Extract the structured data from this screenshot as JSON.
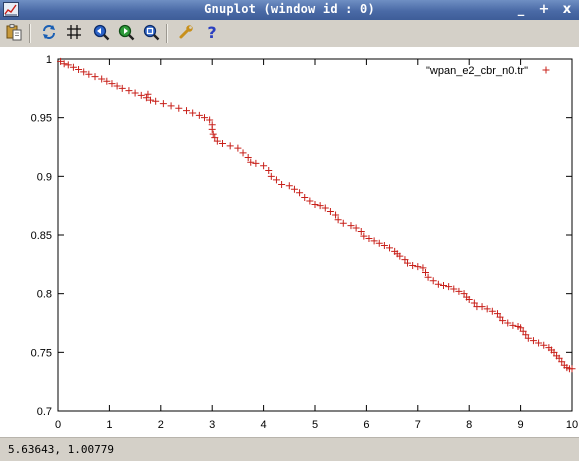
{
  "window": {
    "title": "Gnuplot (window id : 0)",
    "controls": {
      "minimize": "_",
      "maximize": "+",
      "close": "x"
    }
  },
  "toolbar": {
    "buttons": [
      {
        "name": "copy-to-clipboard",
        "icon": "clipboard-icon"
      },
      {
        "name": "replot",
        "icon": "replot-icon"
      },
      {
        "name": "toggle-grid",
        "icon": "grid-icon"
      },
      {
        "name": "previous-zoom",
        "icon": "zoom-previous-icon"
      },
      {
        "name": "next-zoom",
        "icon": "zoom-next-icon"
      },
      {
        "name": "autoscale",
        "icon": "zoom-autoscale-icon"
      },
      {
        "name": "options",
        "icon": "wrench-icon"
      },
      {
        "name": "help",
        "icon": "help-icon"
      }
    ]
  },
  "colors": {
    "series": "#c8201a",
    "titlebar": "#4a6aa6"
  },
  "status": {
    "coordinates": "5.63643,  1.00779"
  },
  "chart_data": {
    "type": "scatter",
    "title": "",
    "xlabel": "",
    "ylabel": "",
    "xlim": [
      0,
      10
    ],
    "ylim": [
      0.7,
      1
    ],
    "x_ticks": [
      0,
      1,
      2,
      3,
      4,
      5,
      6,
      7,
      8,
      9,
      10
    ],
    "y_ticks": [
      0.7,
      0.75,
      0.8,
      0.85,
      0.9,
      0.95,
      1
    ],
    "x_tick_labels": [
      "0",
      "1",
      "2",
      "3",
      "4",
      "5",
      "6",
      "7",
      "8",
      "9",
      "10"
    ],
    "y_tick_labels": [
      "0.7",
      "0.75",
      "0.8",
      "0.85",
      "0.9",
      "0.95",
      "1"
    ],
    "grid": false,
    "legend_position": "top-right",
    "series": [
      {
        "name": "\"wpan_e2_cbr_n0.tr\"",
        "marker": "plus",
        "color": "#c8201a",
        "points": [
          [
            0.05,
            0.998
          ],
          [
            0.12,
            0.996
          ],
          [
            0.2,
            0.995
          ],
          [
            0.3,
            0.993
          ],
          [
            0.4,
            0.991
          ],
          [
            0.5,
            0.989
          ],
          [
            0.6,
            0.987
          ],
          [
            0.72,
            0.985
          ],
          [
            0.85,
            0.983
          ],
          [
            0.95,
            0.981
          ],
          [
            1.05,
            0.979
          ],
          [
            1.15,
            0.977
          ],
          [
            1.25,
            0.975
          ],
          [
            1.38,
            0.973
          ],
          [
            1.5,
            0.971
          ],
          [
            1.62,
            0.969
          ],
          [
            1.72,
            0.967
          ],
          [
            1.75,
            0.97
          ],
          [
            1.8,
            0.965
          ],
          [
            1.9,
            0.964
          ],
          [
            2.05,
            0.962
          ],
          [
            2.2,
            0.96
          ],
          [
            2.35,
            0.958
          ],
          [
            2.5,
            0.956
          ],
          [
            2.62,
            0.954
          ],
          [
            2.75,
            0.952
          ],
          [
            2.85,
            0.95
          ],
          [
            2.95,
            0.948
          ],
          [
            3.0,
            0.944
          ],
          [
            3.0,
            0.94
          ],
          [
            3.02,
            0.936
          ],
          [
            3.05,
            0.933
          ],
          [
            3.1,
            0.93
          ],
          [
            3.2,
            0.928
          ],
          [
            3.35,
            0.926
          ],
          [
            3.5,
            0.924
          ],
          [
            3.6,
            0.92
          ],
          [
            3.7,
            0.916
          ],
          [
            3.75,
            0.912
          ],
          [
            3.85,
            0.911
          ],
          [
            4.0,
            0.909
          ],
          [
            4.1,
            0.905
          ],
          [
            4.15,
            0.9
          ],
          [
            4.25,
            0.897
          ],
          [
            4.35,
            0.893
          ],
          [
            4.5,
            0.892
          ],
          [
            4.6,
            0.889
          ],
          [
            4.7,
            0.886
          ],
          [
            4.8,
            0.882
          ],
          [
            4.9,
            0.879
          ],
          [
            5.0,
            0.876
          ],
          [
            5.1,
            0.875
          ],
          [
            5.2,
            0.873
          ],
          [
            5.3,
            0.87
          ],
          [
            5.4,
            0.867
          ],
          [
            5.45,
            0.863
          ],
          [
            5.55,
            0.86
          ],
          [
            5.7,
            0.858
          ],
          [
            5.8,
            0.856
          ],
          [
            5.9,
            0.853
          ],
          [
            5.95,
            0.849
          ],
          [
            6.05,
            0.847
          ],
          [
            6.15,
            0.845
          ],
          [
            6.25,
            0.843
          ],
          [
            6.35,
            0.841
          ],
          [
            6.45,
            0.839
          ],
          [
            6.55,
            0.836
          ],
          [
            6.6,
            0.834
          ],
          [
            6.65,
            0.832
          ],
          [
            6.75,
            0.829
          ],
          [
            6.8,
            0.826
          ],
          [
            6.9,
            0.824
          ],
          [
            7.0,
            0.823
          ],
          [
            7.1,
            0.822
          ],
          [
            7.15,
            0.818
          ],
          [
            7.2,
            0.814
          ],
          [
            7.3,
            0.811
          ],
          [
            7.4,
            0.808
          ],
          [
            7.5,
            0.807
          ],
          [
            7.6,
            0.806
          ],
          [
            7.7,
            0.804
          ],
          [
            7.8,
            0.802
          ],
          [
            7.9,
            0.8
          ],
          [
            7.95,
            0.797
          ],
          [
            8.0,
            0.795
          ],
          [
            8.1,
            0.792
          ],
          [
            8.15,
            0.789
          ],
          [
            8.25,
            0.789
          ],
          [
            8.35,
            0.787
          ],
          [
            8.45,
            0.785
          ],
          [
            8.55,
            0.783
          ],
          [
            8.6,
            0.78
          ],
          [
            8.65,
            0.777
          ],
          [
            8.75,
            0.775
          ],
          [
            8.85,
            0.773
          ],
          [
            8.95,
            0.772
          ],
          [
            9.0,
            0.771
          ],
          [
            9.05,
            0.768
          ],
          [
            9.1,
            0.765
          ],
          [
            9.15,
            0.762
          ],
          [
            9.25,
            0.76
          ],
          [
            9.35,
            0.758
          ],
          [
            9.45,
            0.756
          ],
          [
            9.55,
            0.754
          ],
          [
            9.6,
            0.752
          ],
          [
            9.65,
            0.75
          ],
          [
            9.7,
            0.747
          ],
          [
            9.75,
            0.745
          ],
          [
            9.8,
            0.742
          ],
          [
            9.85,
            0.739
          ],
          [
            9.9,
            0.737
          ],
          [
            9.95,
            0.736
          ],
          [
            10.0,
            0.736
          ]
        ]
      }
    ]
  }
}
